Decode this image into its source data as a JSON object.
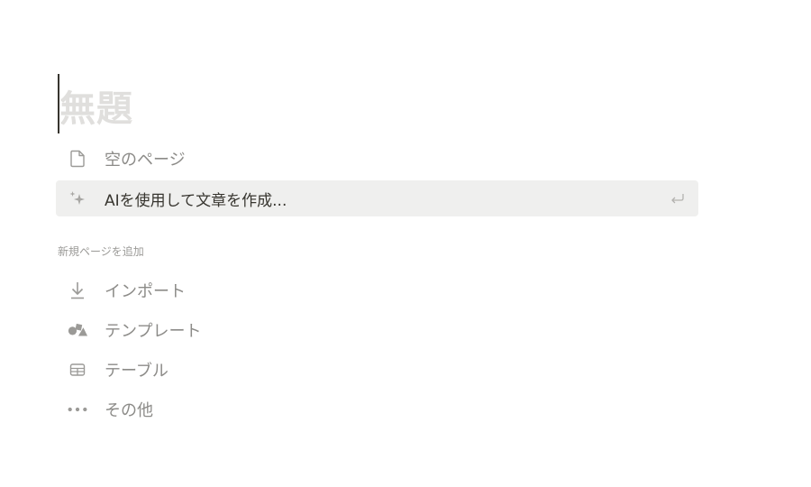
{
  "title_placeholder": "無題",
  "suggestions": [
    {
      "icon": "page-icon",
      "label": "空のページ"
    },
    {
      "icon": "sparkle-icon",
      "label": "AIを使用して文章を作成..."
    }
  ],
  "enter_icon": "return-key-icon",
  "add_section_label": "新規ページを追加",
  "add_items": [
    {
      "icon": "import-arrow-icon",
      "label": "インポート"
    },
    {
      "icon": "template-shapes-icon",
      "label": "テンプレート"
    },
    {
      "icon": "table-icon",
      "label": "テーブル"
    },
    {
      "icon": "more-dots-icon",
      "label": "その他"
    }
  ]
}
